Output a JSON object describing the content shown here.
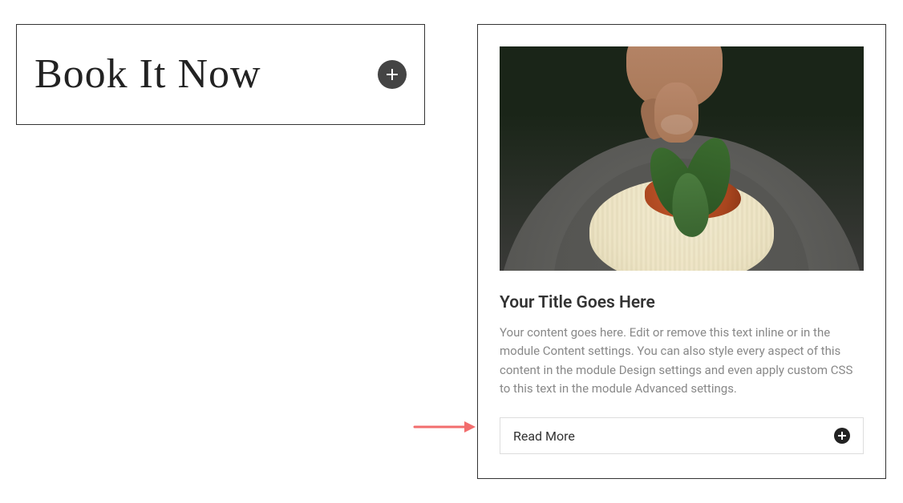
{
  "left": {
    "book_now_label": "Book It Now"
  },
  "card": {
    "title": "Your Title Goes Here",
    "content": "Your content goes here. Edit or remove this text inline or in the module Content settings. You can also style every aspect of this content in the module Design settings and even apply custom CSS to this text in the module Advanced settings.",
    "read_more_label": "Read More",
    "image_alt": "pasta-with-basil"
  },
  "colors": {
    "border": "#333333",
    "text_muted": "#888888",
    "plus_bg_large": "#444444",
    "plus_bg_small": "#222222",
    "arrow": "#f26d6d"
  }
}
